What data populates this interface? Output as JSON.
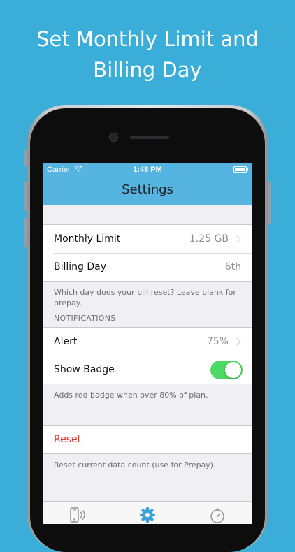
{
  "headline": {
    "line1": "Set Monthly Limit and",
    "line2": "Billing Day"
  },
  "status_bar": {
    "carrier": "Carrier",
    "time": "1:48 PM"
  },
  "nav": {
    "title": "Settings"
  },
  "settings": {
    "monthly_limit": {
      "label": "Monthly Limit",
      "value": "1.25 GB"
    },
    "billing_day": {
      "label": "Billing Day",
      "value": "6th"
    },
    "billing_footer": "Which day does your bill reset? Leave blank for prepay.",
    "notifications_header": "NOTIFICATIONS",
    "alert": {
      "label": "Alert",
      "value": "75%"
    },
    "show_badge": {
      "label": "Show Badge",
      "enabled": true
    },
    "badge_footer": "Adds red badge when over 80% of plan.",
    "reset": {
      "label": "Reset"
    },
    "reset_footer": "Reset current data count (use for Prepay)."
  },
  "tabs": [
    {
      "icon": "phone-signal-icon",
      "selected": false
    },
    {
      "icon": "gear-icon",
      "selected": true
    },
    {
      "icon": "timer-icon",
      "selected": false
    }
  ],
  "colors": {
    "background": "#3aaed8",
    "navbar": "#56b4e1",
    "toggle_on": "#4cd964",
    "destructive": "#e53935",
    "tab_selected": "#3aa2d8",
    "tab_unselected": "#8e8e93"
  }
}
